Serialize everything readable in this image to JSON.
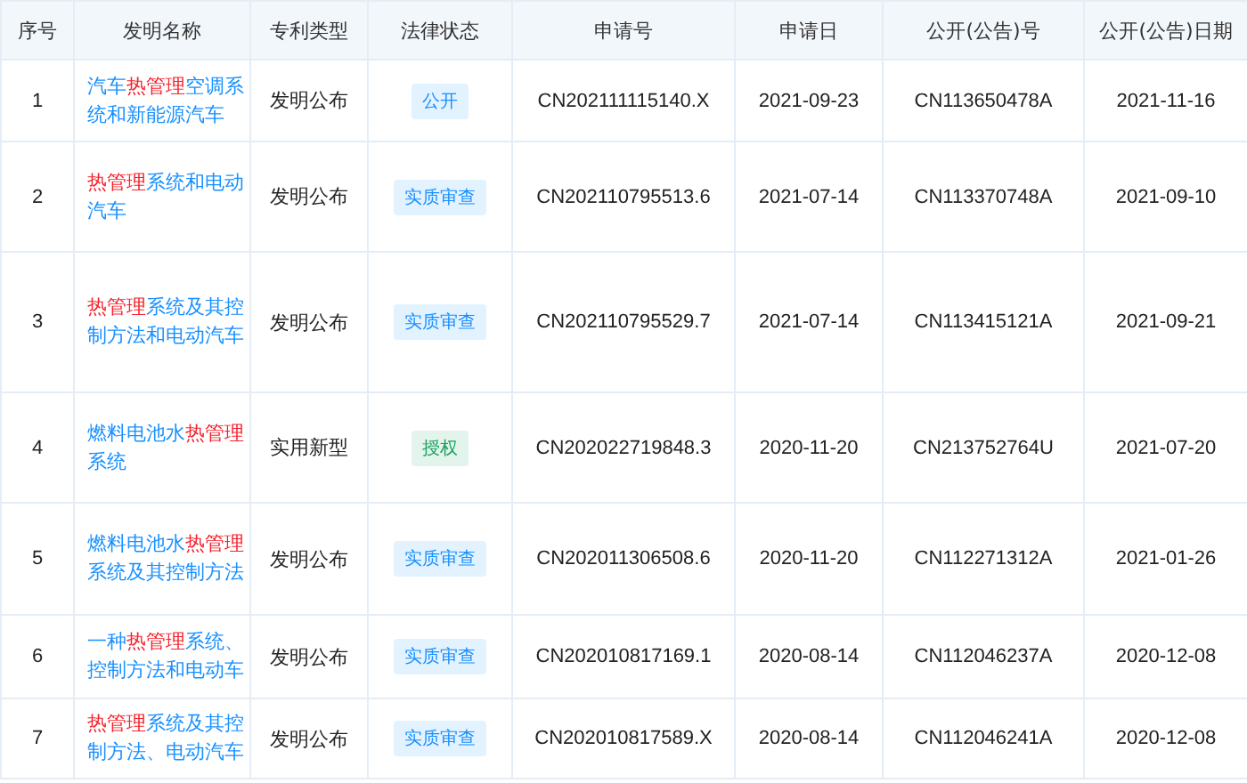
{
  "table": {
    "columns": [
      "序号",
      "发明名称",
      "专利类型",
      "法律状态",
      "申请号",
      "申请日",
      "公开(公告)号",
      "公开(公告)日期"
    ],
    "rows": [
      {
        "index": "1",
        "name": [
          {
            "text": "汽车",
            "highlight": false
          },
          {
            "text": "热管理",
            "highlight": true
          },
          {
            "text": "空调系统和新能源汽车",
            "highlight": false
          }
        ],
        "type": "发明公布",
        "status": {
          "label": "公开",
          "color": "#1890ff"
        },
        "app_no": "CN202111115140.X",
        "app_date": "2021-09-23",
        "pub_no": "CN113650478A",
        "pub_date": "2021-11-16"
      },
      {
        "index": "2",
        "name": [
          {
            "text": "热管理",
            "highlight": true
          },
          {
            "text": "系统和电动汽车",
            "highlight": false
          }
        ],
        "type": "发明公布",
        "status": {
          "label": "实质审查",
          "color": "#1890ff"
        },
        "app_no": "CN202110795513.6",
        "app_date": "2021-07-14",
        "pub_no": "CN113370748A",
        "pub_date": "2021-09-10"
      },
      {
        "index": "3",
        "name": [
          {
            "text": "热管理",
            "highlight": true
          },
          {
            "text": "系统及其控制方法和电动汽车",
            "highlight": false
          }
        ],
        "type": "发明公布",
        "status": {
          "label": "实质审查",
          "color": "#1890ff"
        },
        "app_no": "CN202110795529.7",
        "app_date": "2021-07-14",
        "pub_no": "CN113415121A",
        "pub_date": "2021-09-21"
      },
      {
        "index": "4",
        "name": [
          {
            "text": "燃料电池水",
            "highlight": false
          },
          {
            "text": "热管理",
            "highlight": true
          },
          {
            "text": "系统",
            "highlight": false
          }
        ],
        "type": "实用新型",
        "status": {
          "label": "授权",
          "color": "#19a15f"
        },
        "app_no": "CN202022719848.3",
        "app_date": "2020-11-20",
        "pub_no": "CN213752764U",
        "pub_date": "2021-07-20"
      },
      {
        "index": "5",
        "name": [
          {
            "text": "燃料电池水",
            "highlight": false
          },
          {
            "text": "热管理",
            "highlight": true
          },
          {
            "text": "系统及其控制方法",
            "highlight": false
          }
        ],
        "type": "发明公布",
        "status": {
          "label": "实质审查",
          "color": "#1890ff"
        },
        "app_no": "CN202011306508.6",
        "app_date": "2020-11-20",
        "pub_no": "CN112271312A",
        "pub_date": "2021-01-26"
      },
      {
        "index": "6",
        "name": [
          {
            "text": "一种",
            "highlight": false
          },
          {
            "text": "热管理",
            "highlight": true
          },
          {
            "text": "系统、控制方法和电动车",
            "highlight": false
          }
        ],
        "type": "发明公布",
        "status": {
          "label": "实质审查",
          "color": "#1890ff"
        },
        "app_no": "CN202010817169.1",
        "app_date": "2020-08-14",
        "pub_no": "CN112046237A",
        "pub_date": "2020-12-08"
      },
      {
        "index": "7",
        "name": [
          {
            "text": "热管理",
            "highlight": true
          },
          {
            "text": "系统及其控制方法、电动汽车",
            "highlight": false
          }
        ],
        "type": "发明公布",
        "status": {
          "label": "实质审查",
          "color": "#1890ff"
        },
        "app_no": "CN202010817589.X",
        "app_date": "2020-08-14",
        "pub_no": "CN112046241A",
        "pub_date": "2020-12-08"
      }
    ]
  }
}
